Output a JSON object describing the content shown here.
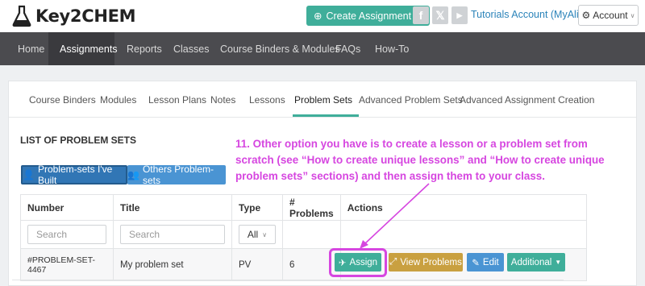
{
  "header": {
    "logo_text": "Key2CHEM",
    "create_assignment_label": "Create Assignment",
    "tutorials_account": "Tutorials Account (MyAlias)",
    "account_label": "Account"
  },
  "nav": {
    "items": [
      "Home",
      "Assignments",
      "Reports",
      "Classes",
      "Course Binders & Modules",
      "FAQs",
      "How-To"
    ],
    "active": "Assignments"
  },
  "tabs": {
    "items": [
      "Course Binders",
      "Modules",
      "Lesson Plans",
      "Notes",
      "Lessons",
      "Problem Sets",
      "Advanced Problem Sets",
      "Advanced Assignment Creation"
    ],
    "active": "Problem Sets"
  },
  "section": {
    "title": "LIST OF PROBLEM SETS",
    "btn_built": "Problem-sets I've Built",
    "btn_others": "Others Problem-sets"
  },
  "table": {
    "headers": [
      "Number",
      "Title",
      "Type",
      "# Problems",
      "Actions"
    ],
    "search_placeholder": "Search",
    "type_filter": "All",
    "row": {
      "number": "#PROBLEM-SET-4467",
      "title": "My problem set",
      "type": "PV",
      "problems": "6"
    },
    "actions": {
      "assign": "Assign",
      "view_problems": "View Problems",
      "edit": "Edit",
      "additional": "Additional"
    }
  },
  "annotation": "11. Other option you have is to create a lesson or a problem set from scratch (see “How to create unique lessons” and “How to create unique problem sets” sections) and then assign them to your class.",
  "colors": {
    "accent_teal": "#3fae9a",
    "annotation_magenta": "#d646e0",
    "primary_blue": "#3176b5",
    "gold": "#c9a040"
  }
}
